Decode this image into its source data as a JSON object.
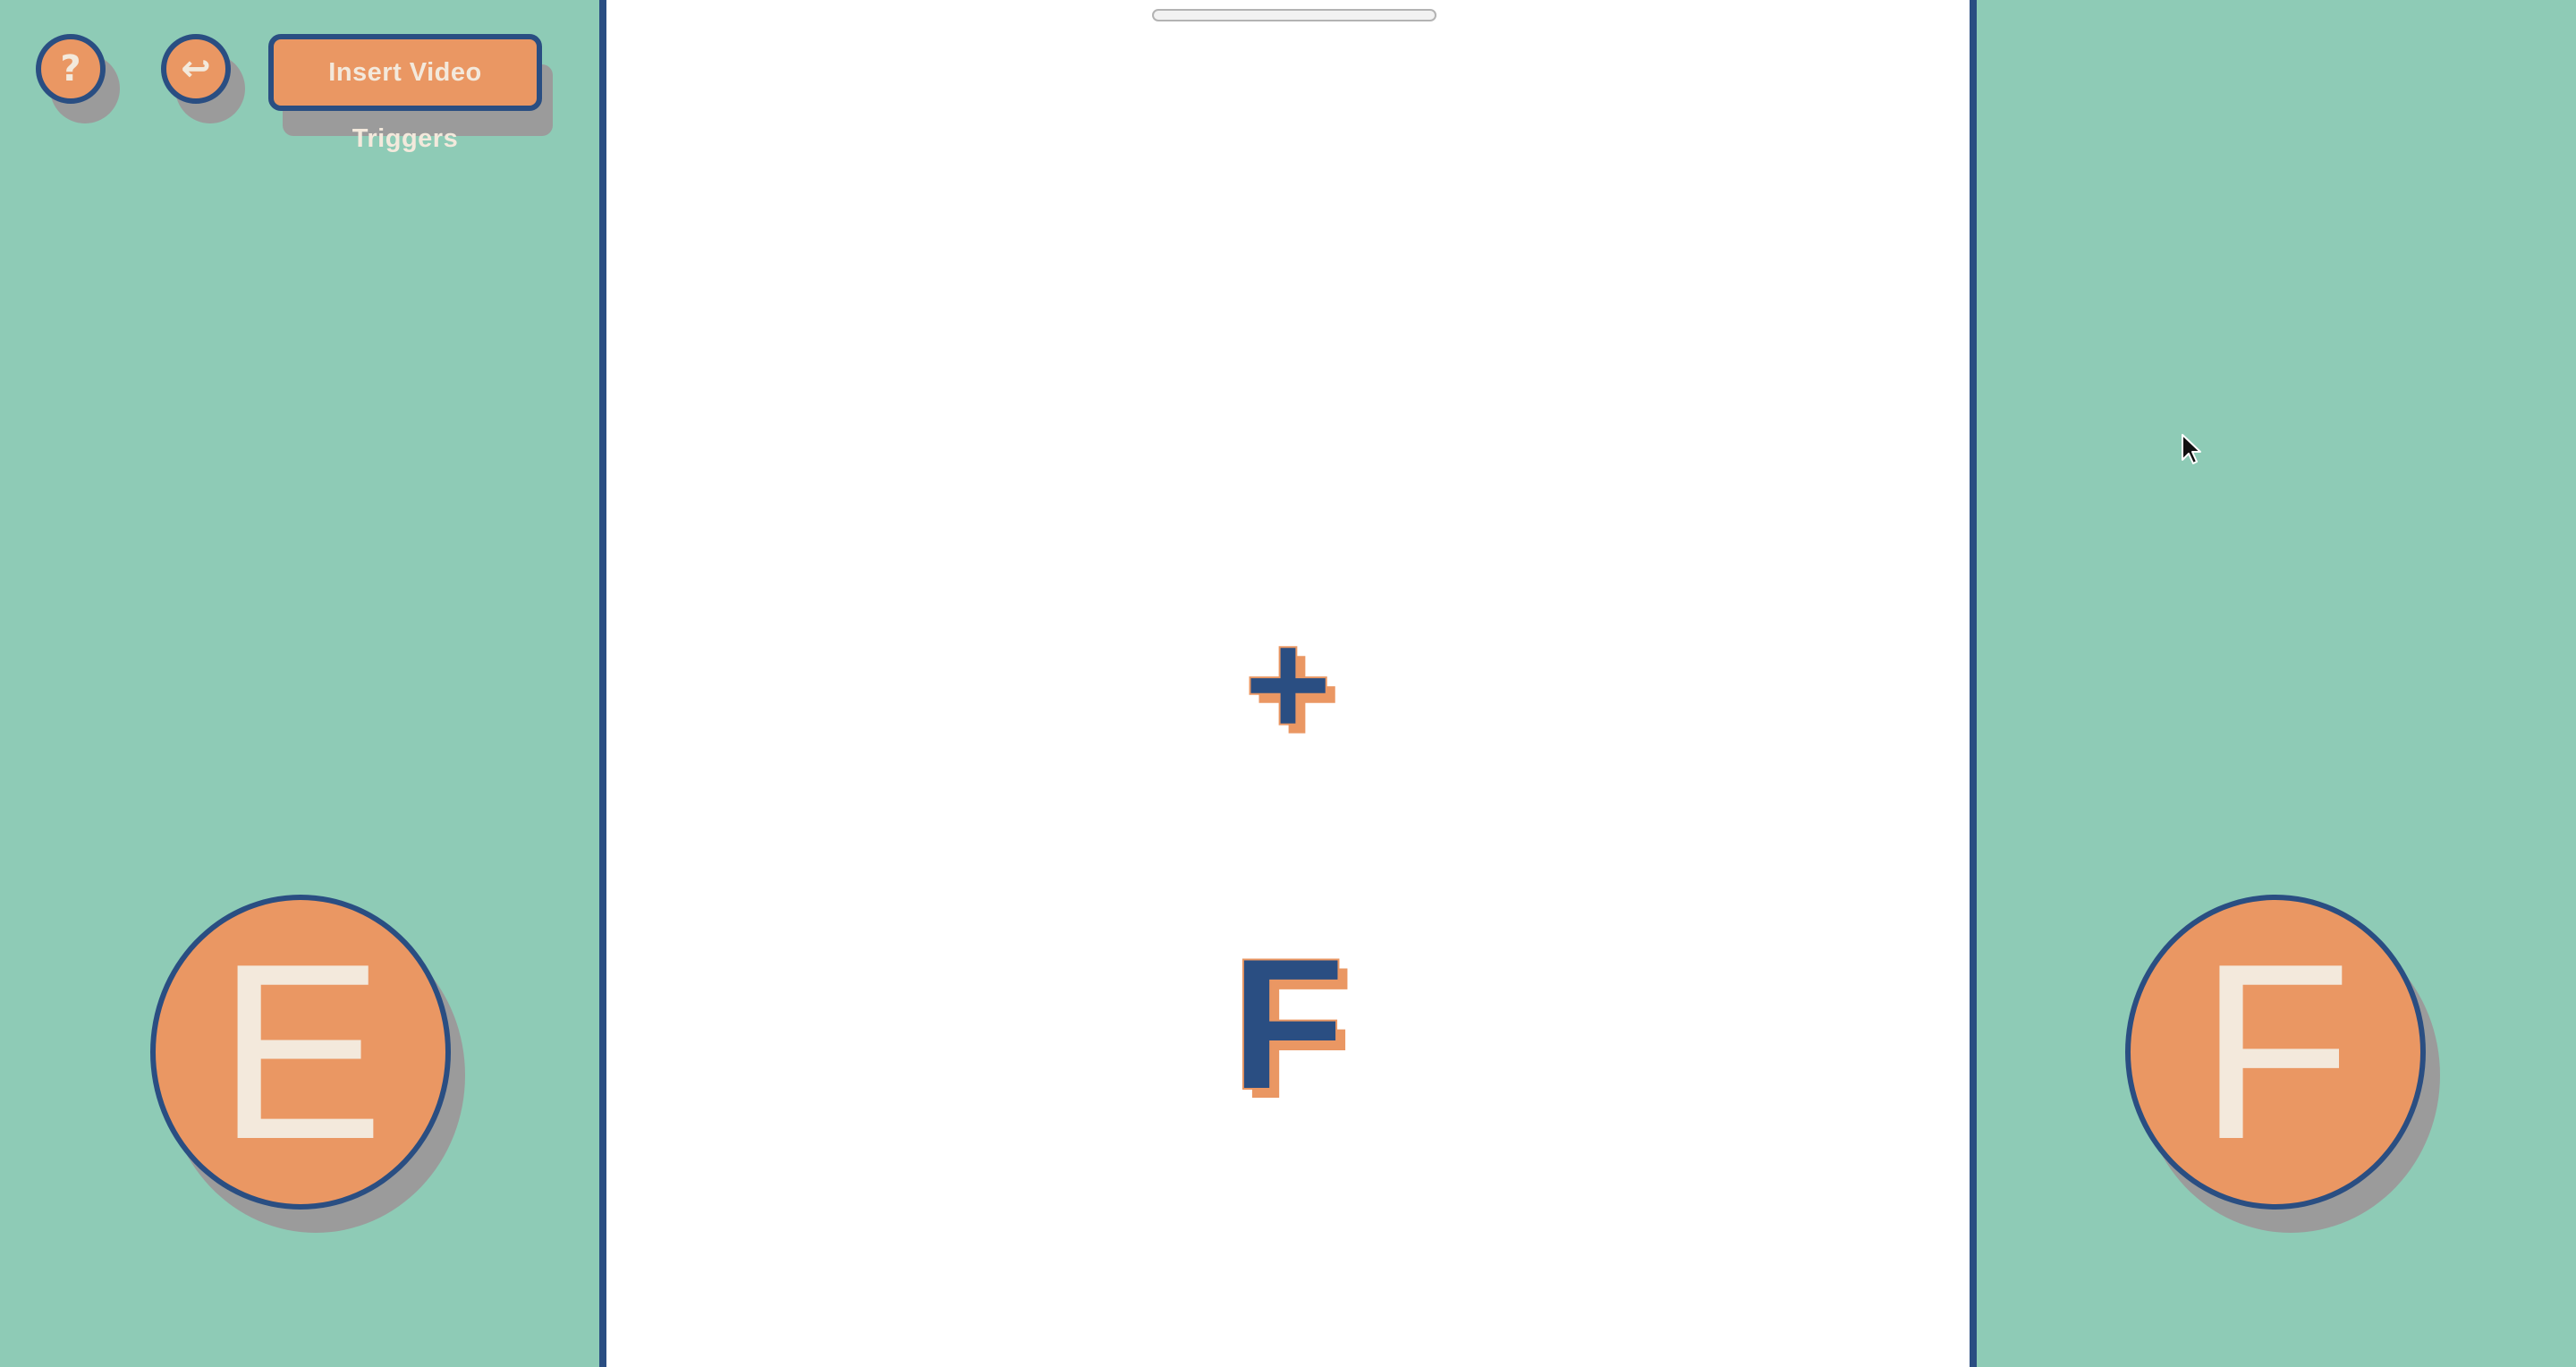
{
  "toolbar": {
    "help_label": "?",
    "back_label": "↩",
    "video_triggers_label": "Insert Video Triggers"
  },
  "stimulus": {
    "fixation": "+",
    "target_letter": "F"
  },
  "answers": {
    "left_label": "E",
    "right_label": "F"
  },
  "colors": {
    "background": "#8ecbb6",
    "stage": "#ffffff",
    "accent": "#ea9763",
    "outline": "#2a4e82",
    "button_text": "#f3e9dc",
    "shadow": "#9b9b9b"
  },
  "icons": {
    "help": "question-mark-icon",
    "back": "return-arrow-icon",
    "cursor": "mouse-pointer-icon"
  }
}
